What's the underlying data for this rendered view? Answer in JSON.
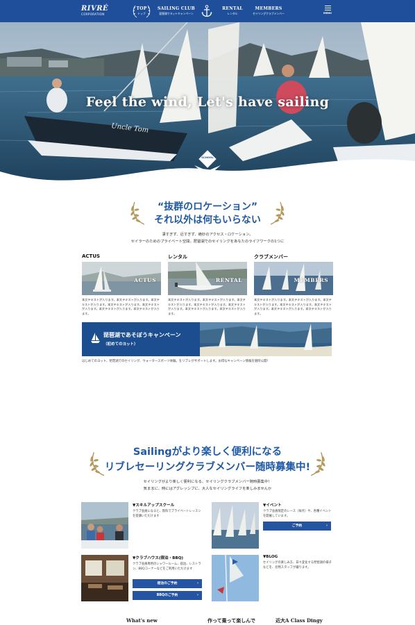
{
  "header": {
    "logo_main": "RIVRÉ",
    "logo_sub": "CORPORATION",
    "nav": [
      {
        "title": "TOP",
        "sub": "トップ"
      },
      {
        "title": "SAILING CLUB",
        "sub": "琵琶湖でヨットキャンペーン"
      },
      {
        "title": "RENTAL",
        "sub": "レンタル"
      },
      {
        "title": "MEMBERS",
        "sub": "セイリングクラブメンバー"
      }
    ],
    "menu_label": "MENU"
  },
  "hero": {
    "title": "Feel the wind, Let's have sailing",
    "badge": "SCHOOL",
    "boat_name": "Uncle Tom"
  },
  "section1": {
    "title_line1": "“抜群のロケーション”",
    "title_line2": "それ以外は何もいらない",
    "lead_line1": "凄すぎず、近すぎず、絶妙のアクセス・ロケーション。",
    "lead_line2": "セイラーのためのプライベート空間。琵琶湖でのセイリングをあなたのライフワークの1つに",
    "cards": [
      {
        "heading": "ACTUS",
        "image_label": "ACTUS",
        "text": "本文テキストが入ります。本文テキストが入ります。本文テキストが入ります。本文テキストが入ります。本文テキストが入ります。本文テキストが入ります。本文テキストが入ります。"
      },
      {
        "heading": "レンタル",
        "image_label": "RENTAL",
        "text": "本文テキストが入ります。本文テキストが入ります。本文テキストが入ります。本文テキストが入ります。本文テキストが入ります。本文テキストが入ります。本文テキストが入ります。"
      },
      {
        "heading": "クラブメンバー",
        "image_label": "MEMBERS",
        "text": "本文テキストが入ります。本文テキストが入ります。本文テキストが入ります。本文テキストが入ります。本文テキストが入ります。本文テキストが入ります。本文テキストが入ります。"
      }
    ],
    "banner_title": "琵琶湖であそぼうキャンペーン",
    "banner_sub": "（初めてのヨット）",
    "banner_desc": "はじめてのヨット、琵琶湖でのセイリング、ウォータースポーツ体験。をリブレがサポートします。お得なキャンペーン情報を随時公開！"
  },
  "section2": {
    "title_line1": "Sailingがより楽しく便利になる",
    "title_line2": "リブレセーリングクラブメンバー随時募集中!",
    "lead_line1": "セイリングがより楽しく便利になる、セイリングクラブメンバー随時募集中！",
    "lead_line2": "気ままに、時にはアグレッシブに、大人なセイリングライフを楽しみませんか",
    "features": [
      {
        "heading": "▼スキルアップスクール",
        "text": "クラブ会員になると、無料でプライベートレッスンを受講いただけます"
      },
      {
        "heading": "▼イベント",
        "text": "クラブ会員限定のレース（毎月）や、各種イベントを開催しています。"
      },
      {
        "heading": "▼クラブハウス(宿泊・BBQ)",
        "text": "クラブ会員専用のシャワールーム、宿泊、レストラン、BBQコーナーなどをご利用いただけます"
      },
      {
        "heading": "▼BLOG",
        "text": "セイリングの楽しみ方、日々変化する琵琶湖の様子などを、名物スタッフが綴ります。"
      }
    ],
    "btn_event": "ご予約",
    "btn_stay": "宿泊のご予約",
    "btn_bbq": "BBQのご予約"
  },
  "footer_headings": [
    "What's new",
    "作って乗って楽しんで",
    "近大A Class Dingy"
  ],
  "colors": {
    "brand_blue": "#1f4f9a",
    "title_blue": "#1f5aa6",
    "wreath_gold": "#b5985b"
  }
}
